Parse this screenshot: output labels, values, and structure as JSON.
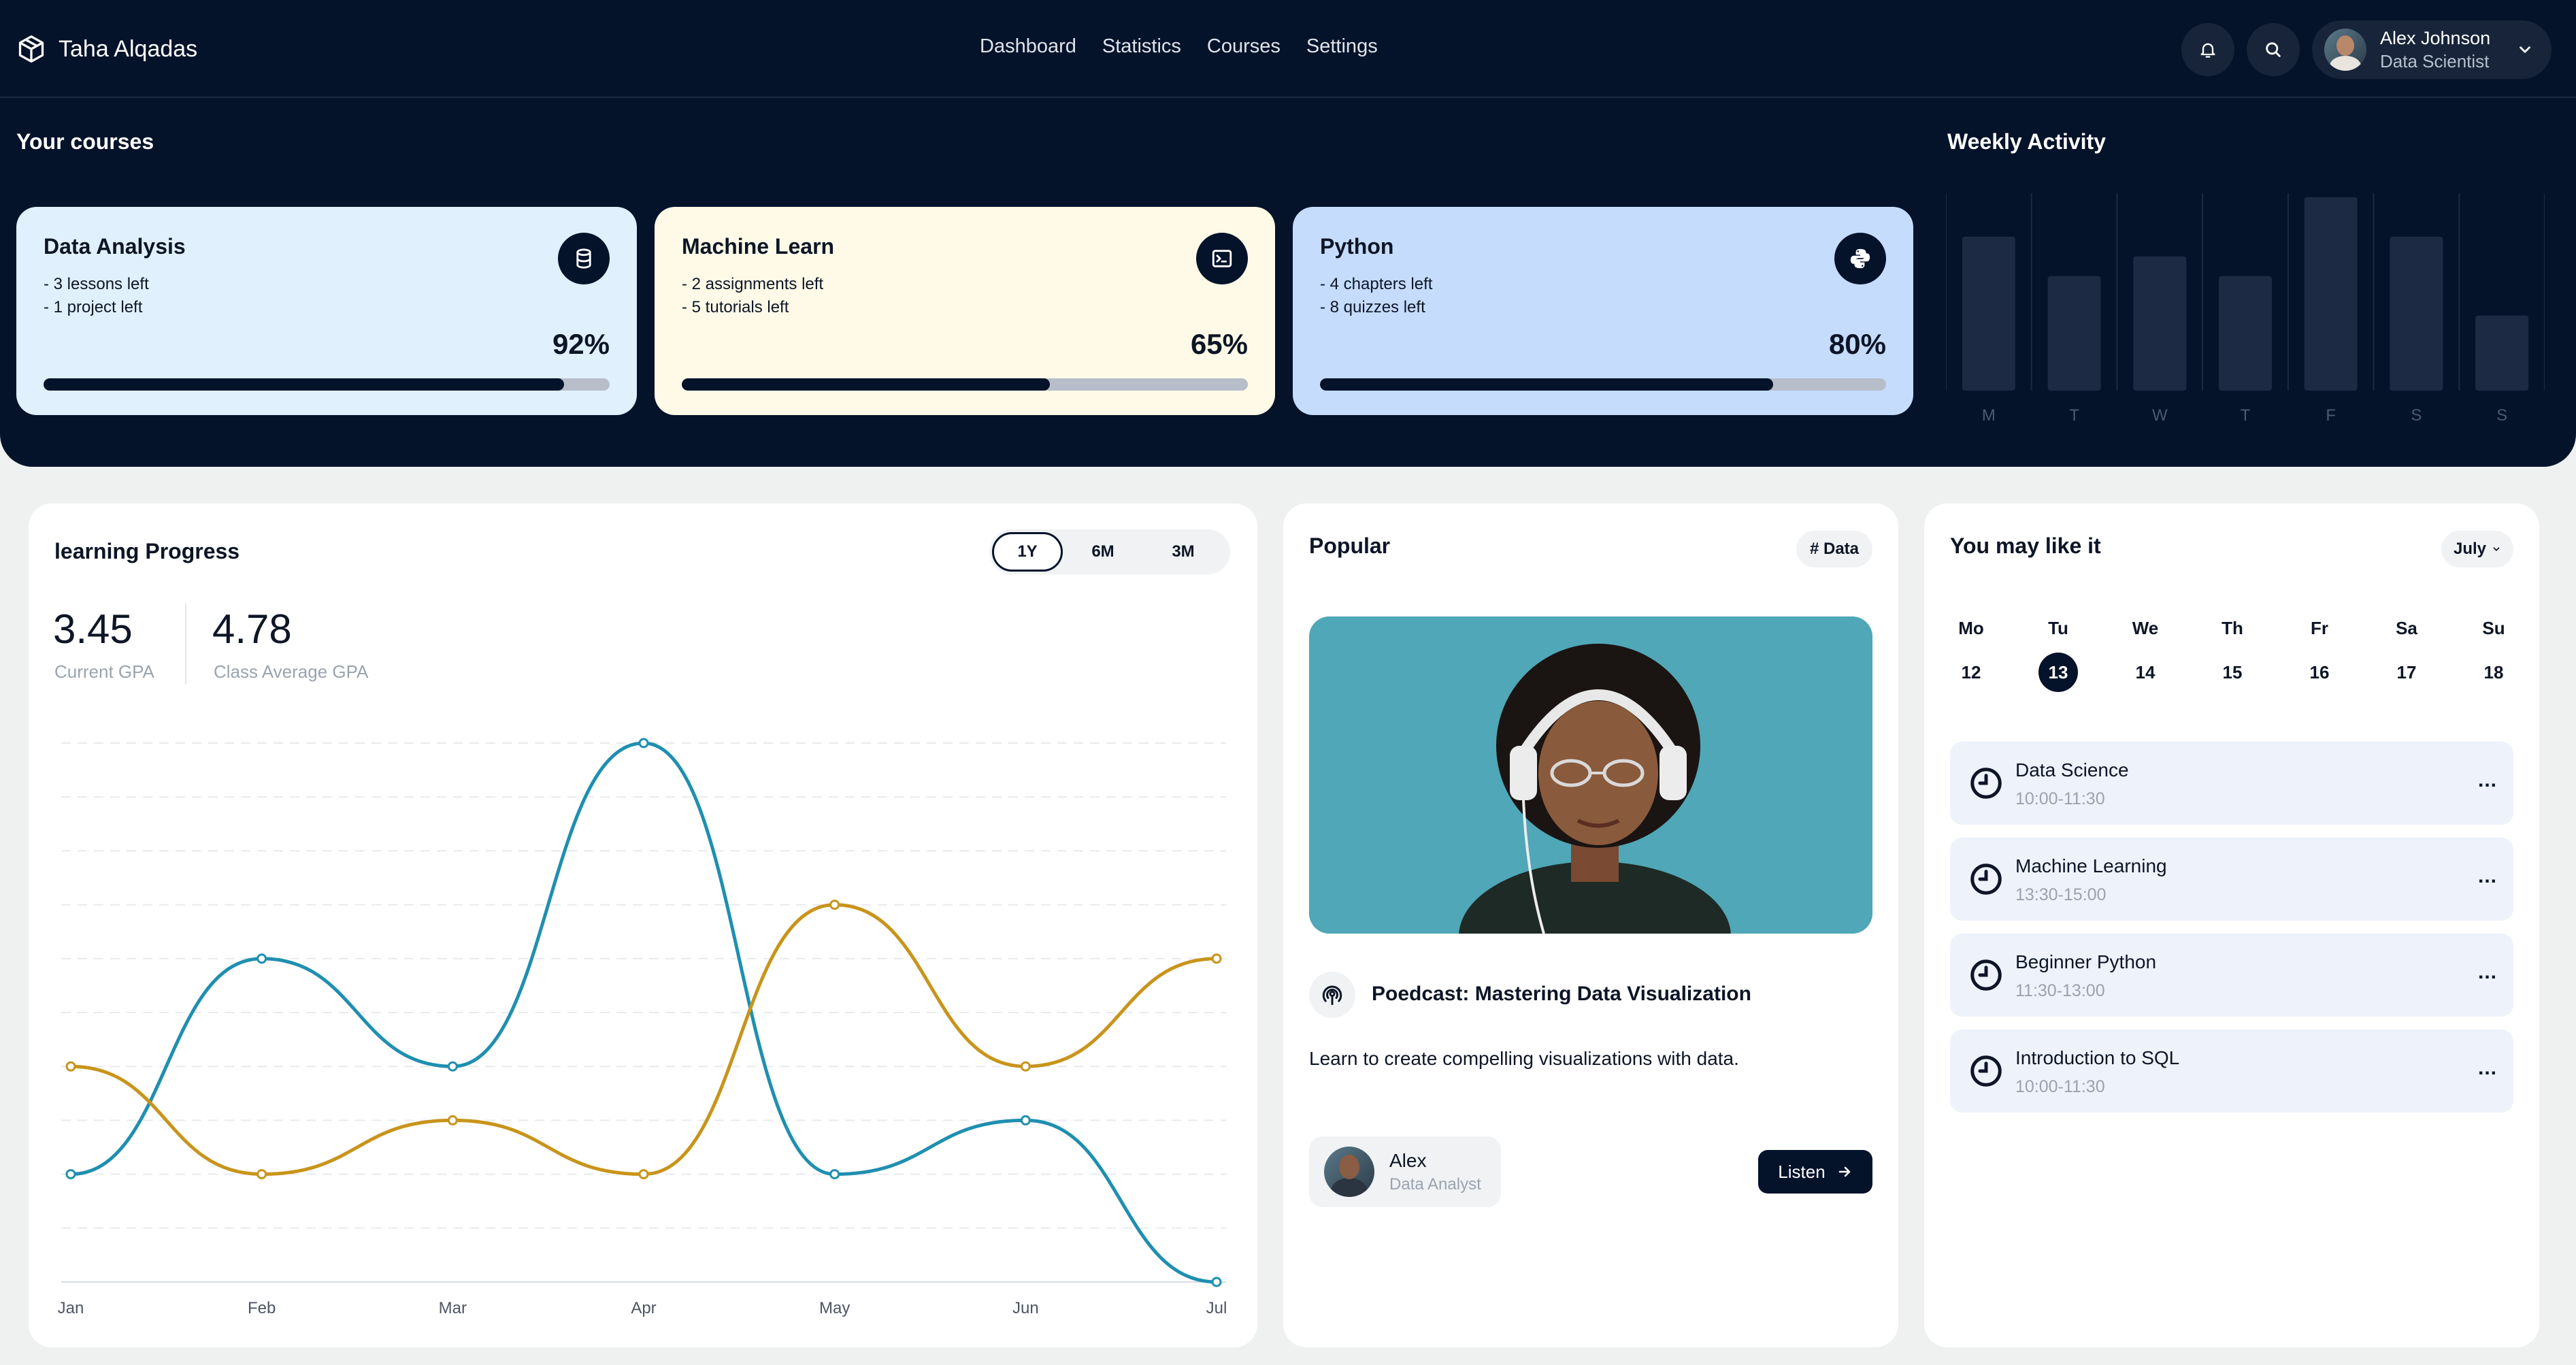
{
  "brand": {
    "name": "Taha Alqadas",
    "logo_icon": "cube-logo-icon"
  },
  "nav": {
    "items": [
      "Dashboard",
      "Statistics",
      "Courses",
      "Settings"
    ]
  },
  "header": {
    "notification_icon": "bell-icon",
    "search_icon": "search-icon",
    "user": {
      "name": "Alex Johnson",
      "role": "Data Scientist"
    }
  },
  "courses": {
    "title": "Your courses",
    "items": [
      {
        "title": "Data Analysis",
        "lines": [
          "- 3 lessons left",
          "- 1 project left"
        ],
        "percent_label": "92%",
        "progress": 0.92,
        "color": "#e1f0fd",
        "icon": "database-icon"
      },
      {
        "title": "Machine Learn",
        "lines": [
          "- 2 assignments left",
          "- 5 tutorials left"
        ],
        "percent_label": "65%",
        "progress": 0.65,
        "color": "#fefae7",
        "icon": "terminal-icon"
      },
      {
        "title": "Python",
        "lines": [
          "- 4 chapters left",
          "- 8 quizzes left"
        ],
        "percent_label": "80%",
        "progress": 0.8,
        "color": "#c5dcfc",
        "icon": "python-icon"
      }
    ]
  },
  "weekly": {
    "title": "Weekly Activity",
    "days": [
      "M",
      "T",
      "W",
      "T",
      "F",
      "S",
      "S"
    ],
    "values": [
      0.78,
      0.58,
      0.68,
      0.58,
      0.98,
      0.78,
      0.38
    ]
  },
  "progress": {
    "title": "learning Progress",
    "ranges": [
      "1Y",
      "6M",
      "3M"
    ],
    "active_range": "1Y",
    "current_gpa": "3.45",
    "current_gpa_label": "Current GPA",
    "class_avg": "4.78",
    "class_avg_label": "Class Average GPA"
  },
  "chart_data": {
    "type": "line",
    "categories": [
      "Jan",
      "Feb",
      "Mar",
      "Apr",
      "May",
      "Jun",
      "Jul"
    ],
    "series": [
      {
        "color": "#1f8fb0",
        "values": [
          2,
          6,
          4,
          10,
          2,
          3,
          0
        ]
      },
      {
        "color": "#c8941a",
        "values": [
          4,
          2,
          3,
          2,
          7,
          4,
          6
        ]
      }
    ],
    "ylim": [
      0,
      10
    ],
    "grid": true,
    "title": "",
    "xlabel": "",
    "ylabel": ""
  },
  "popular": {
    "title": "Popular",
    "tag": "# Data",
    "podcast_icon": "podcast-icon",
    "podcast_title": "Poedcast: Mastering Data Visualization",
    "description": "Learn to create compelling visualizations with data.",
    "author": {
      "name": "Alex",
      "role": "Data Analyst"
    },
    "listen_label": "Listen"
  },
  "like": {
    "title": "You may like it",
    "month": "July",
    "days": [
      {
        "name": "Mo",
        "num": "12"
      },
      {
        "name": "Tu",
        "num": "13",
        "selected": true
      },
      {
        "name": "We",
        "num": "14"
      },
      {
        "name": "Th",
        "num": "15"
      },
      {
        "name": "Fr",
        "num": "16"
      },
      {
        "name": "Sa",
        "num": "17"
      },
      {
        "name": "Su",
        "num": "18"
      }
    ],
    "events": [
      {
        "title": "Data Science",
        "time": "10:00-11:30"
      },
      {
        "title": "Machine Learning",
        "time": "13:30-15:00"
      },
      {
        "title": "Beginner Python",
        "time": "11:30-13:00"
      },
      {
        "title": "Introduction to SQL",
        "time": "10:00-11:30"
      }
    ],
    "event_icon": "clock-icon",
    "more_label": "..."
  }
}
